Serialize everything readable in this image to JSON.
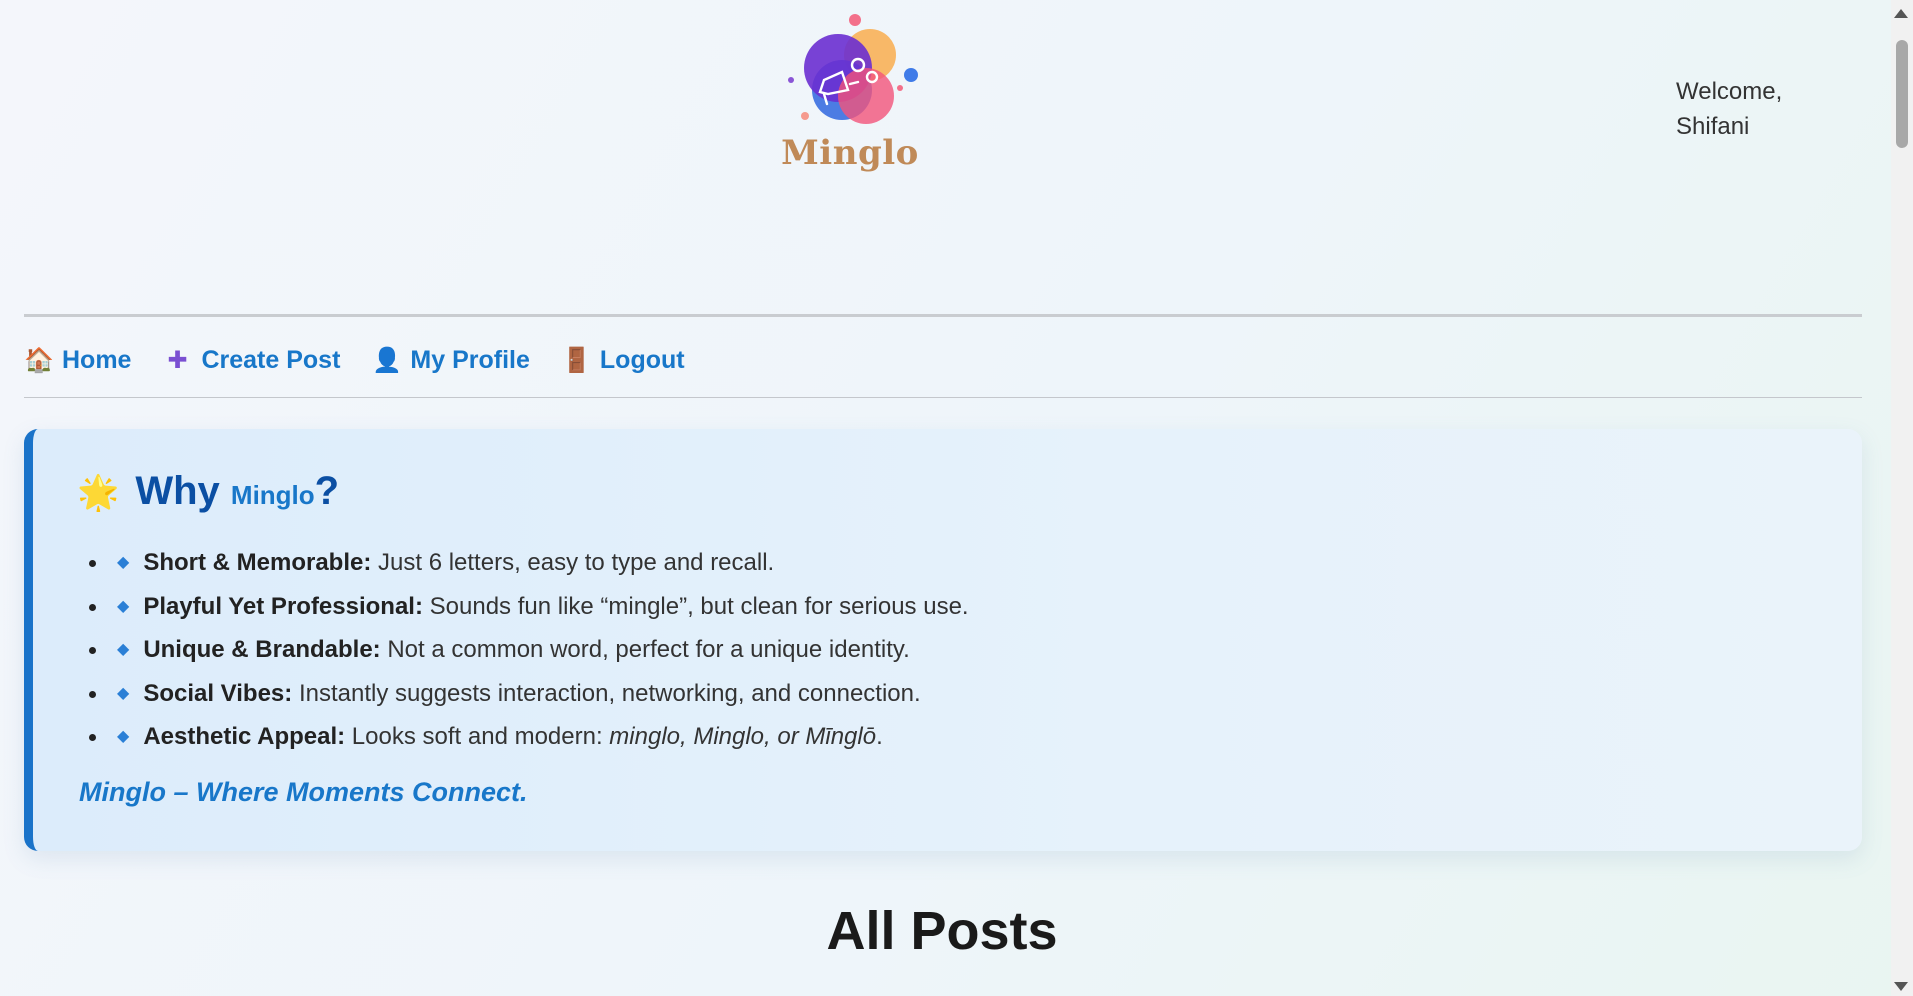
{
  "header": {
    "logo_text": "Minglo",
    "welcome_text": "Welcome, Shifani"
  },
  "nav": {
    "items": [
      {
        "icon": "🏠",
        "label": "Home"
      },
      {
        "icon": "✚",
        "label": "Create Post"
      },
      {
        "icon": "👤",
        "label": "My Profile"
      },
      {
        "icon": "🚪",
        "label": "Logout"
      }
    ]
  },
  "why": {
    "star_icon": "🌟",
    "heading": "Why",
    "brand": "Minglo",
    "question_mark": "?",
    "points": [
      {
        "title": "Short & Memorable:",
        "text": " Just 6 letters, easy to type and recall."
      },
      {
        "title": "Playful Yet Professional:",
        "text": " Sounds fun like “mingle”, but clean for serious use."
      },
      {
        "title": "Unique & Brandable:",
        "text": " Not a common word, perfect for a unique identity."
      },
      {
        "title": "Social Vibes:",
        "text": " Instantly suggests interaction, networking, and connection."
      },
      {
        "title": "Aesthetic Appeal:",
        "text": " Looks soft and modern: ",
        "emphasis": "minglo, Minglo, or Mīnglō",
        "suffix": "."
      }
    ],
    "tagline": "Minglo – Where Moments Connect."
  },
  "posts": {
    "title": "All Posts"
  },
  "colors": {
    "accent": "#1877c9",
    "heading": "#0b4fa3",
    "box_border": "#1a73c9",
    "logo_text": "#c08a58"
  }
}
